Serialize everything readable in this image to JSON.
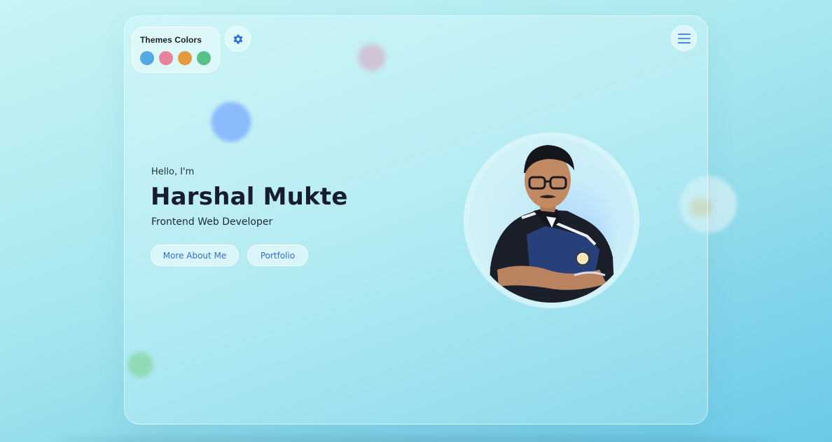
{
  "app": {
    "background_colors": [
      "#c8f4f4",
      "#a6e6ee",
      "#7fd3ea",
      "#6bc9e6"
    ]
  },
  "themes": {
    "title": "Themes Colors",
    "swatches": [
      {
        "name": "blue",
        "color": "#54a9e3"
      },
      {
        "name": "pink",
        "color": "#e7839b"
      },
      {
        "name": "orange",
        "color": "#e39a3a"
      },
      {
        "name": "green",
        "color": "#58c08a"
      }
    ]
  },
  "toolbar": {
    "settings_icon": "gear-icon",
    "menu_icon": "hamburger-menu-icon"
  },
  "hero": {
    "greeting": "Hello, I'm",
    "name": "Harshal Mukte",
    "role": "Frontend Web Developer",
    "buttons": {
      "about": "More About Me",
      "portfolio": "Portfolio"
    },
    "accent_color": "#2f6fd6",
    "avatar_icon": "profile-photo"
  }
}
